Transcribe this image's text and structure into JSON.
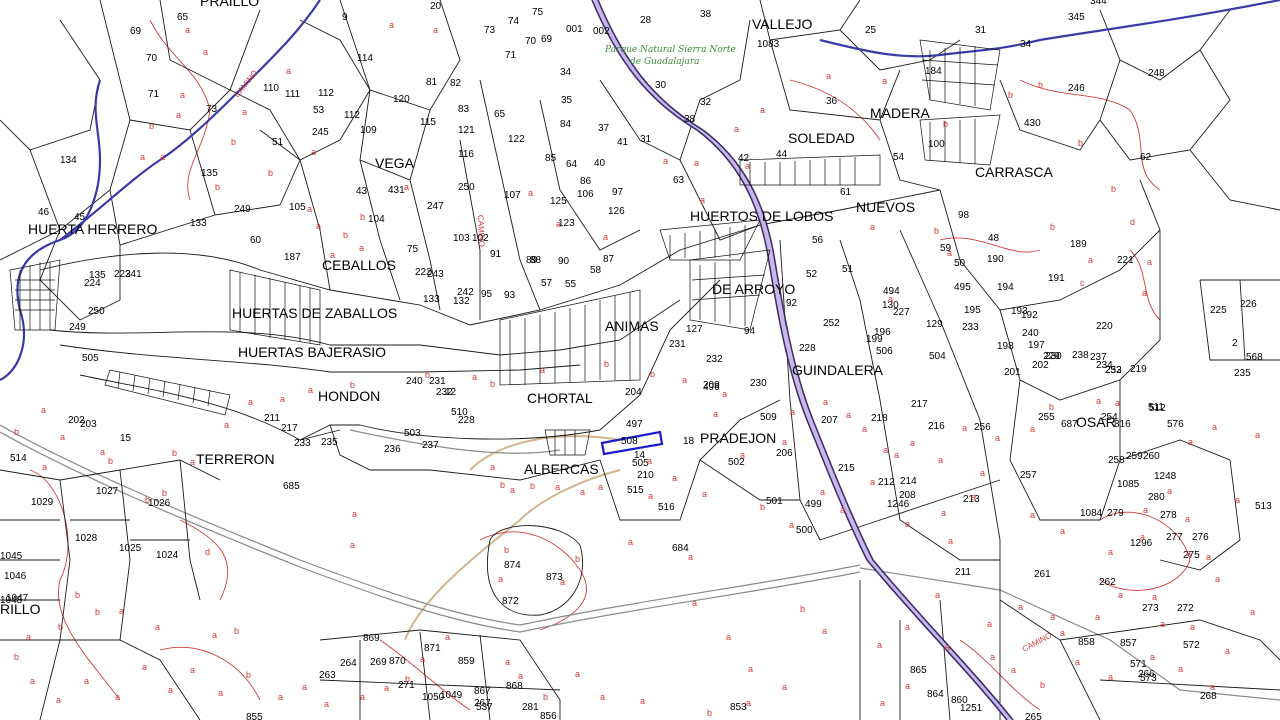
{
  "park_label": [
    "Parque Natural Sierra Norte",
    "de Guadalajara"
  ],
  "road_labels": [
    "CAMINO",
    "CAMINO",
    "CAMINO"
  ],
  "place_names": [
    "PRAILLO",
    "VALLEJO",
    "MADERA",
    "SOLEDAD",
    "VEGA",
    "CARRASCA",
    "NUEVOS",
    "HUERTA HERRERO",
    "HUERTOS DE LOBOS",
    "CEBALLOS",
    "DE ARROYO",
    "HUERTAS DE ZABALLOS",
    "ANIMAS",
    "HUERTAS BAJERASIO",
    "GUINDALERA",
    "HONDON",
    "CHORTAL",
    "PRADEJON",
    "OSAR",
    "TERRERON",
    "ALBERCAS",
    "RILLO"
  ],
  "parcel_numbers": [
    "69",
    "65",
    "9",
    "74",
    "75",
    "28",
    "38",
    "345",
    "344",
    "31",
    "70",
    "110",
    "114",
    "20",
    "73",
    "71",
    "70",
    "69",
    "001",
    "002",
    "1083",
    "25",
    "34",
    "71",
    "81",
    "65",
    "34",
    "30",
    "32",
    "184",
    "248",
    "111",
    "82",
    "35",
    "246",
    "73",
    "112",
    "120",
    "83",
    "36",
    "53",
    "112",
    "115",
    "121",
    "84",
    "37",
    "38",
    "31",
    "430",
    "51",
    "245",
    "109",
    "116",
    "122",
    "85",
    "64",
    "40",
    "41",
    "42",
    "44",
    "54",
    "100",
    "134",
    "135",
    "250",
    "107",
    "106",
    "86",
    "63",
    "62",
    "43",
    "431",
    "247",
    "125",
    "126",
    "97",
    "61",
    "46",
    "45",
    "133",
    "249",
    "105",
    "104",
    "123",
    "98",
    "60",
    "187",
    "75",
    "103",
    "102",
    "91",
    "90",
    "87",
    "56",
    "59",
    "48",
    "189",
    "221",
    "222",
    "243",
    "242",
    "95",
    "93",
    "89",
    "88",
    "57",
    "55",
    "58",
    "52",
    "51",
    "50",
    "190",
    "191",
    "224",
    "223",
    "241",
    "135",
    "133",
    "132",
    "127",
    "94",
    "92",
    "494",
    "495",
    "194",
    "192",
    "225",
    "226",
    "2",
    "250",
    "249",
    "252",
    "130",
    "129",
    "195",
    "193",
    "220",
    "228",
    "227",
    "240",
    "199",
    "196",
    "233",
    "198",
    "197",
    "229",
    "230",
    "231",
    "232",
    "506",
    "504",
    "201",
    "202",
    "219",
    "234",
    "235",
    "238",
    "237",
    "232",
    "253",
    "568",
    "505",
    "496",
    "230",
    "240",
    "231",
    "232",
    "12",
    "510",
    "497",
    "509",
    "204",
    "207",
    "218",
    "217",
    "216",
    "256",
    "255",
    "254",
    "511",
    "512",
    "508",
    "14",
    "18",
    "15",
    "202",
    "203",
    "211",
    "217",
    "233",
    "235",
    "236",
    "237",
    "228",
    "503",
    "502",
    "206",
    "215",
    "214",
    "213",
    "257",
    "258",
    "259",
    "260",
    "1248",
    "513",
    "514",
    "505",
    "210",
    "209",
    "208",
    "1246",
    "212",
    "1084",
    "1085",
    "279",
    "280",
    "278",
    "277",
    "276",
    "1027",
    "1026",
    "515",
    "516",
    "501",
    "685",
    "499",
    "500",
    "1029",
    "1028",
    "1025",
    "1024",
    "874",
    "873",
    "872",
    "684",
    "211",
    "261",
    "262",
    "1296",
    "275",
    "273",
    "272",
    "1045",
    "1046",
    "1047",
    "1048",
    "869",
    "870",
    "871",
    "859",
    "263",
    "264",
    "269",
    "271",
    "1050",
    "1049",
    "867",
    "868",
    "865",
    "864",
    "860",
    "858",
    "857",
    "571",
    "572",
    "573",
    "266",
    "268",
    "265",
    "267",
    "537",
    "281",
    "856",
    "855",
    "853",
    "1251",
    "687",
    "816",
    "576"
  ],
  "highlighted_parcel": "511"
}
